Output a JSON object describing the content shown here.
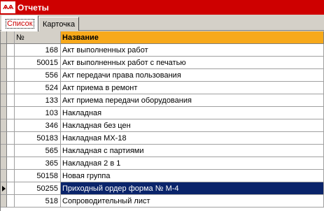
{
  "window": {
    "title": "Отчеты",
    "icon_text": "ѦѦ",
    "title_bg": "#ce0000"
  },
  "tabs": [
    {
      "label": "Список",
      "active": true
    },
    {
      "label": "Карточка",
      "active": false
    }
  ],
  "table": {
    "columns": [
      "№",
      "Название"
    ],
    "header_accent": "#f7a91b",
    "selection_color": "#0a246a",
    "rows": [
      {
        "num": "168",
        "name": "Акт выполненных работ"
      },
      {
        "num": "50015",
        "name": "Акт выполненных работ с печатью"
      },
      {
        "num": "556",
        "name": "Акт передачи права пользования"
      },
      {
        "num": "524",
        "name": "Акт приема в ремонт"
      },
      {
        "num": "133",
        "name": "Акт приема передачи оборудования"
      },
      {
        "num": "103",
        "name": "Накладная"
      },
      {
        "num": "346",
        "name": "Накладная без цен"
      },
      {
        "num": "50183",
        "name": "Накладная МХ-18"
      },
      {
        "num": "565",
        "name": "Накладная с партиями"
      },
      {
        "num": "365",
        "name": "Накладная 2 в 1"
      },
      {
        "num": "50158",
        "name": "Новая группа"
      },
      {
        "num": "50255",
        "name": "Приходный ордер форма № М-4",
        "selected": true
      },
      {
        "num": "518",
        "name": "Сопроводительный лист"
      }
    ]
  }
}
